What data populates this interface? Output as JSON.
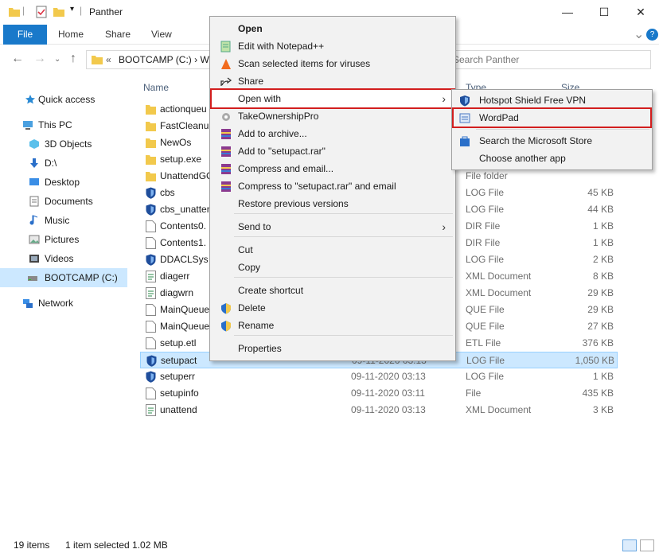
{
  "window": {
    "title": "Panther",
    "minimize_glyph": "—",
    "maximize_glyph": "☐",
    "close_glyph": "✕"
  },
  "ribbon": {
    "tabs": [
      "File",
      "Home",
      "Share",
      "View"
    ],
    "expand_glyph": "⌄",
    "help_glyph": "?"
  },
  "address": {
    "path_prefix": "«",
    "path": "BOOTCAMP (C:)  ›  W",
    "search_placeholder": "Search Panther"
  },
  "nav": {
    "items": [
      {
        "label": "Quick access",
        "icon": "star-icon"
      },
      {
        "label": "This PC",
        "icon": "computer-icon"
      },
      {
        "label": "3D Objects",
        "icon": "cube-icon"
      },
      {
        "label": "D:\\",
        "icon": "download-icon"
      },
      {
        "label": "Desktop",
        "icon": "desktop-icon"
      },
      {
        "label": "Documents",
        "icon": "document-icon"
      },
      {
        "label": "Music",
        "icon": "music-icon"
      },
      {
        "label": "Pictures",
        "icon": "picture-icon"
      },
      {
        "label": "Videos",
        "icon": "video-icon"
      },
      {
        "label": "BOOTCAMP (C:)",
        "icon": "drive-icon"
      },
      {
        "label": "Network",
        "icon": "network-icon"
      }
    ]
  },
  "columns": {
    "name": "Name",
    "type": "Type",
    "size": "Size"
  },
  "files": [
    {
      "name": "actionqueu",
      "date": "",
      "type": "",
      "size": "",
      "icon": "folder"
    },
    {
      "name": "FastCleanup",
      "date": "",
      "type": "",
      "size": "",
      "icon": "folder"
    },
    {
      "name": "NewOs",
      "date": "",
      "type": "",
      "size": "",
      "icon": "folder"
    },
    {
      "name": "setup.exe",
      "date": "",
      "type": "",
      "size": "",
      "icon": "folder"
    },
    {
      "name": "UnattendGC",
      "date": "",
      "type": "File folder",
      "size": "",
      "icon": "folder"
    },
    {
      "name": "cbs",
      "date": "",
      "type": "LOG File",
      "size": "45 KB",
      "icon": "log"
    },
    {
      "name": "cbs_unatten",
      "date": "",
      "type": "LOG File",
      "size": "44 KB",
      "icon": "log"
    },
    {
      "name": "Contents0.",
      "date": "",
      "type": "DIR File",
      "size": "1 KB",
      "icon": "blank"
    },
    {
      "name": "Contents1.",
      "date": "",
      "type": "DIR File",
      "size": "1 KB",
      "icon": "blank"
    },
    {
      "name": "DDACLSys",
      "date": "",
      "type": "LOG File",
      "size": "2 KB",
      "icon": "log"
    },
    {
      "name": "diagerr",
      "date": "",
      "type": "XML Document",
      "size": "8 KB",
      "icon": "xml"
    },
    {
      "name": "diagwrn",
      "date": "",
      "type": "XML Document",
      "size": "29 KB",
      "icon": "xml"
    },
    {
      "name": "MainQueue",
      "date": "",
      "type": "QUE File",
      "size": "29 KB",
      "icon": "blank"
    },
    {
      "name": "MainQueue",
      "date": "",
      "type": "QUE File",
      "size": "27 KB",
      "icon": "blank"
    },
    {
      "name": "setup.etl",
      "date": "",
      "type": "ETL File",
      "size": "376 KB",
      "icon": "blank"
    },
    {
      "name": "setupact",
      "date": "09-11-2020 03:13",
      "type": "LOG File",
      "size": "1,050 KB",
      "icon": "log"
    },
    {
      "name": "setuperr",
      "date": "09-11-2020 03:13",
      "type": "LOG File",
      "size": "1 KB",
      "icon": "log"
    },
    {
      "name": "setupinfo",
      "date": "09-11-2020 03:11",
      "type": "File",
      "size": "435 KB",
      "icon": "blank"
    },
    {
      "name": "unattend",
      "date": "09-11-2020 03:13",
      "type": "XML Document",
      "size": "3 KB",
      "icon": "xml"
    }
  ],
  "status": {
    "count": "19 items",
    "selection": "1 item selected  1.02 MB"
  },
  "context_menu": {
    "items": [
      {
        "label": "Open",
        "bold": true
      },
      {
        "label": "Edit with Notepad++"
      },
      {
        "label": "Scan selected items for viruses"
      },
      {
        "label": "Share"
      },
      {
        "label": "Open with"
      },
      {
        "label": "TakeOwnershipPro"
      },
      {
        "label": "Add to archive..."
      },
      {
        "label": "Add to \"setupact.rar\""
      },
      {
        "label": "Compress and email..."
      },
      {
        "label": "Compress to \"setupact.rar\" and email"
      },
      {
        "label": "Restore previous versions"
      },
      {
        "label": "Send to"
      },
      {
        "label": "Cut"
      },
      {
        "label": "Copy"
      },
      {
        "label": "Create shortcut"
      },
      {
        "label": "Delete"
      },
      {
        "label": "Rename"
      },
      {
        "label": "Properties"
      }
    ],
    "arrow_glyph": "›"
  },
  "submenu": {
    "items": [
      {
        "label": "Hotspot Shield Free VPN"
      },
      {
        "label": "WordPad"
      },
      {
        "label": "Search the Microsoft Store"
      },
      {
        "label": "Choose another app"
      }
    ]
  },
  "colors": {
    "accent": "#1979ca",
    "selection": "#cce8ff",
    "highlight_border": "#d21e1e",
    "folder": "#f2c94c"
  }
}
